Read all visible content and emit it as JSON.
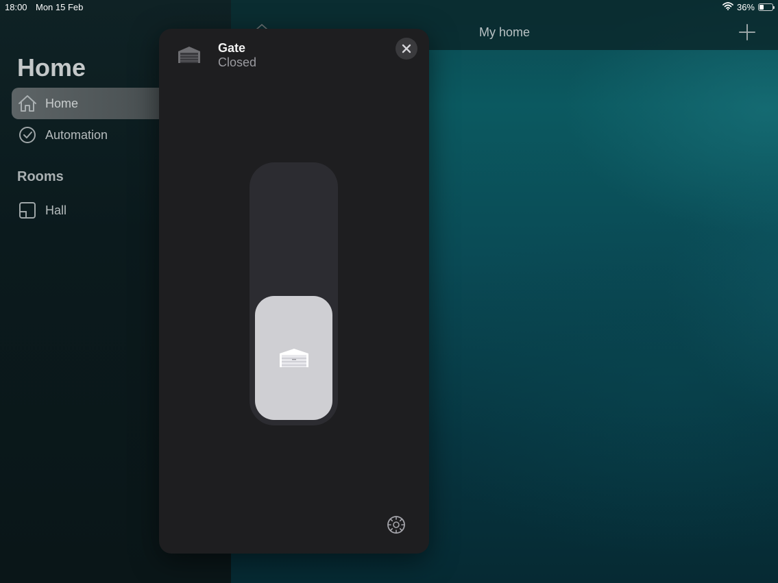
{
  "status_bar": {
    "time": "18:00",
    "date": "Mon 15 Feb",
    "battery_percent_text": "36%",
    "battery_level": 0.36
  },
  "sidebar": {
    "title": "Home",
    "items": [
      {
        "label": "Home",
        "icon": "house-icon",
        "active": true
      },
      {
        "label": "Automation",
        "icon": "clock-icon",
        "active": false
      }
    ],
    "rooms_title": "Rooms",
    "rooms": [
      {
        "label": "Hall",
        "icon": "room-icon"
      }
    ]
  },
  "main": {
    "title": "My home",
    "add_icon": "plus-icon"
  },
  "accessory_card": {
    "name": "Gate",
    "status": "Closed",
    "icon": "garage-door-icon",
    "close_icon": "close-icon",
    "settings_icon": "gear-icon",
    "position_level": 0
  },
  "colors": {
    "card_background": "#1e1e20",
    "knob": "#cfcfd3",
    "track": "#2c2c31",
    "sidebar_active": "#5d6466",
    "wallpaper_teal": "#0b5960"
  }
}
